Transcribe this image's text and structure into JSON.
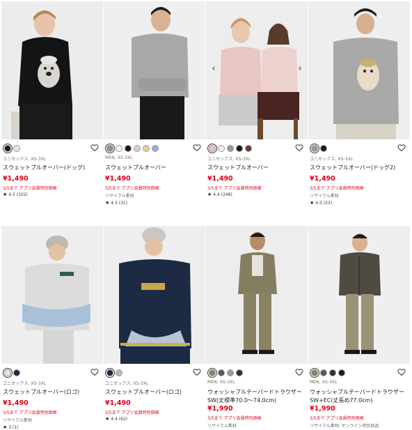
{
  "colors": {
    "price_red": "#e2001a",
    "text_dark": "#1b1b1b",
    "text_gray": "#6a6a6a"
  },
  "icons": {
    "favorite": "heart-outline-icon",
    "rating": "star-icon",
    "carousel_prev": "chevron-left-icon",
    "carousel_next": "chevron-right-icon"
  },
  "products": [
    {
      "meta": "ユニセックス, XS-3XL",
      "name": "スウェットプルオーバー(ドッグ)",
      "price": "¥1,490",
      "promo": "3/5まで アプリ会員特別価格",
      "note": "",
      "rating": "4.5",
      "reviews": "(102)",
      "swatches": [
        "#1a1a1a",
        "#e6e6e6"
      ],
      "selected_swatch": 0
    },
    {
      "meta": "MEN, XS-3XL",
      "name": "スウェットプルオーバー",
      "price": "¥1,490",
      "promo": "3/5まで アプリ会員特別価格",
      "note": "リサイクル素材",
      "rating": "4.3",
      "reviews": "(31)",
      "swatches": [
        "#8e8e8e",
        "#f2f2f2",
        "#1a1a1a",
        "#e9c9c9",
        "#e2d0a0",
        "#8fb2df"
      ],
      "selected_swatch": 0
    },
    {
      "meta": "ユニセックス, XS-3XL",
      "name": "スウェットプルオーバー",
      "price": "¥1,490",
      "promo": "3/5まで アプリ会員特別価格",
      "note": "",
      "rating": "4.4",
      "reviews": "(248)",
      "swatches": [
        "#e9c6c6",
        "#f2f2f2",
        "#9a9a9a",
        "#1a1a1a",
        "#6b3a2f"
      ],
      "selected_swatch": 0
    },
    {
      "meta": "ユニセックス, XS-3XL",
      "name": "スウェットプルオーバー(ドッグ2)",
      "price": "¥1,490",
      "promo": "3/5まで アプリ会員特別価格",
      "note": "リサイクル素材",
      "rating": "4.5",
      "reviews": "(23)",
      "swatches": [
        "#9a9a9a",
        "#1a1a1a"
      ],
      "selected_swatch": 0
    },
    {
      "meta": "ユニセックス, XS-3XL",
      "name": "スウェットプルオーバー(ロゴ)",
      "price": "¥1,490",
      "promo": "3/5まで アプリ会員特別価格",
      "note": "リサイクル素材",
      "rating": "3",
      "reviews": "(1)",
      "swatches": [
        "#e6e6e6",
        "#1c2a44"
      ],
      "selected_swatch": 0
    },
    {
      "meta": "ユニセックス, XS-3XL",
      "name": "スウェットプルオーバー(ロゴ)",
      "price": "¥1,490",
      "promo": "3/5まで アプリ会員特別価格",
      "note": "",
      "rating": "4.4",
      "reviews": "(62)",
      "swatches": [
        "#1c2a44",
        "#b8b8b8"
      ],
      "selected_swatch": 0
    },
    {
      "meta": "MEN, XS-3XL",
      "name": "ウォッシャブルテーパードトラウザーSW(丈標準70.0〜74.0cm)",
      "price": "¥1,990",
      "promo": "3/5まで アプリ会員特別価格",
      "note": "リサイクル素材",
      "rating": "",
      "reviews": "",
      "swatches": [
        "#8a8363",
        "#5a5a5a",
        "#9a9a9a",
        "#2a2f3f"
      ],
      "selected_swatch": 0
    },
    {
      "meta": "MEN, XS-3XL",
      "name": "ウォッシャブルテーパードトラウザーSW+EC(丈長め77.0cm)",
      "price": "¥1,990",
      "promo": "3/5まで アプリ会員特別価格",
      "note": "リサイクル素材, オンライン特別商品",
      "rating": "",
      "reviews": "",
      "swatches": [
        "#8a8363",
        "#5a5a5a",
        "#2a2f3f",
        "#1a1a1a"
      ],
      "selected_swatch": 0
    }
  ]
}
